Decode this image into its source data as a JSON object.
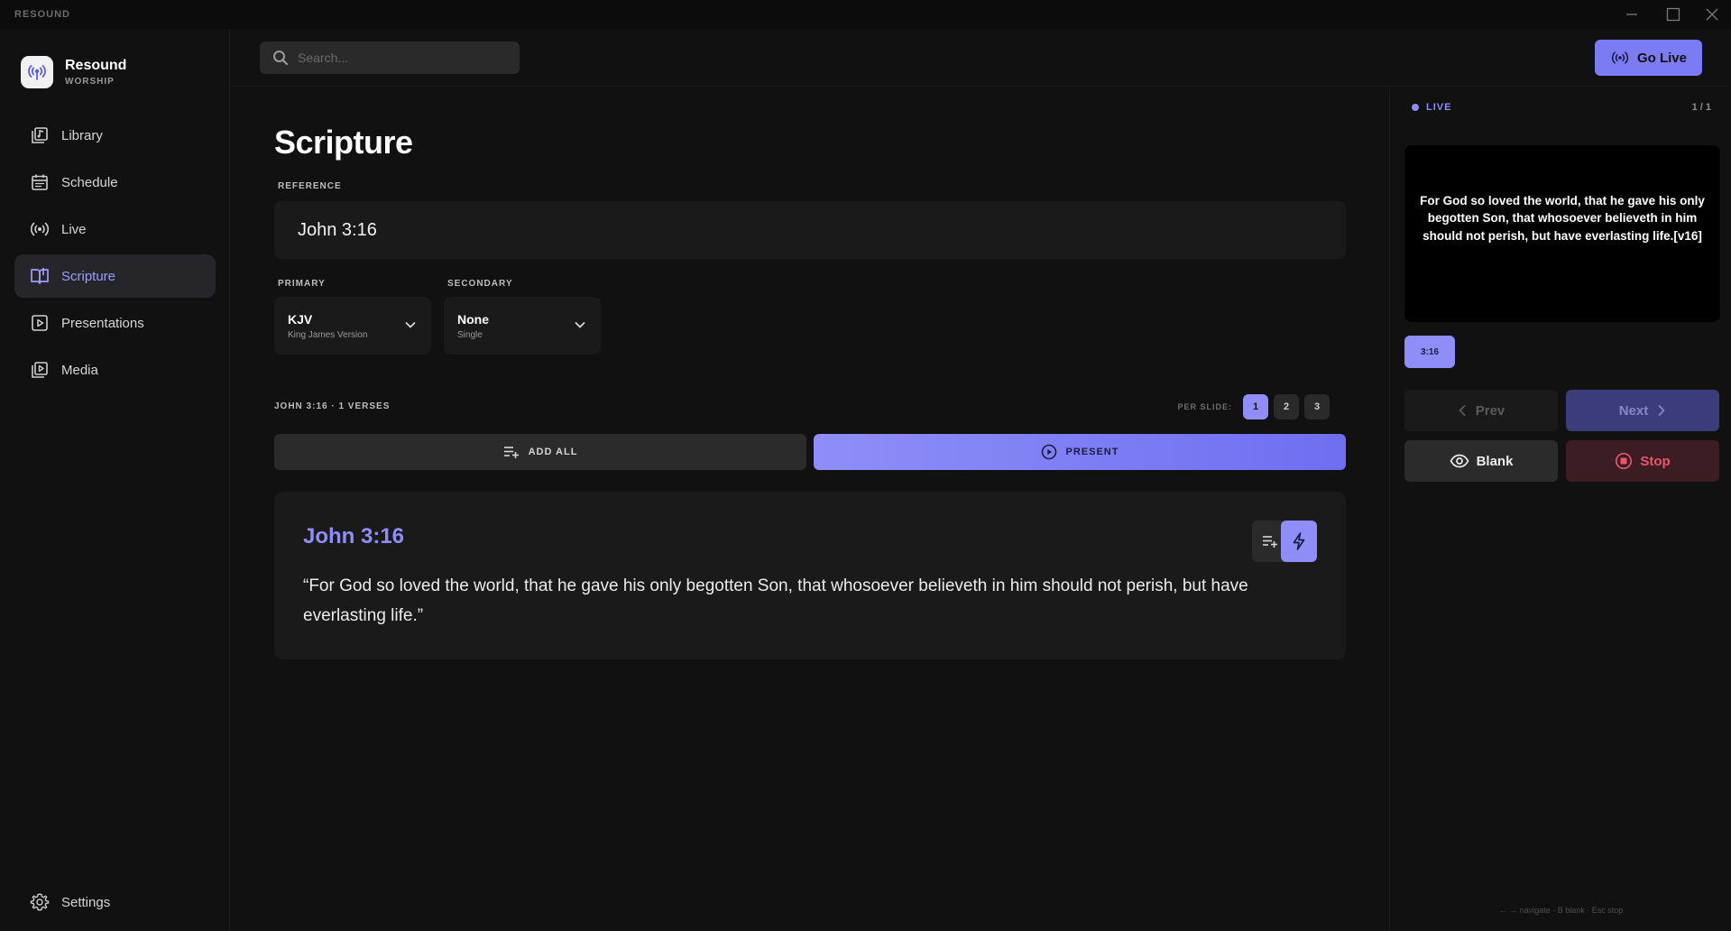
{
  "window": {
    "title": "RESOUND"
  },
  "brand": {
    "name": "Resound",
    "subtitle": "WORSHIP"
  },
  "sidebar": {
    "items": [
      {
        "label": "Library",
        "icon": "library-icon"
      },
      {
        "label": "Schedule",
        "icon": "calendar-icon"
      },
      {
        "label": "Live",
        "icon": "broadcast-icon"
      },
      {
        "label": "Scripture",
        "icon": "book-icon",
        "active": true
      },
      {
        "label": "Presentations",
        "icon": "play-square-icon"
      },
      {
        "label": "Media",
        "icon": "media-icon"
      }
    ],
    "settings_label": "Settings"
  },
  "topbar": {
    "search_placeholder": "Search...",
    "go_live_label": "Go Live"
  },
  "scripture": {
    "title": "Scripture",
    "reference_label": "REFERENCE",
    "reference_value": "John 3:16",
    "primary_label": "PRIMARY",
    "primary_value": "KJV",
    "primary_sub": "King James Version",
    "secondary_label": "SECONDARY",
    "secondary_value": "None",
    "secondary_sub": "Single",
    "count_label": "JOHN 3:16 · 1 VERSES",
    "per_slide_label": "PER SLIDE:",
    "per_slide_options": [
      "1",
      "2",
      "3"
    ],
    "per_slide_selected": "1",
    "add_all_label": "ADD ALL",
    "present_label": "PRESENT",
    "verse": {
      "ref": "John 3:16",
      "text": "“For God so loved the world, that he gave his only begotten Son, that whosoever believeth in him should not perish, but have everlasting life.”"
    }
  },
  "live_panel": {
    "status": "LIVE",
    "counter": "1 / 1",
    "preview_text": "For God so loved the world, that he gave his only begotten Son, that whosoever believeth in him should not perish, but have everlasting life.[v16]",
    "slide_chip": "3:16",
    "prev_label": "Prev",
    "next_label": "Next",
    "blank_label": "Blank",
    "stop_label": "Stop",
    "hint": "← → navigate · B blank · Esc stop"
  },
  "colors": {
    "accent": "#8f8ef8",
    "background": "#111111",
    "panel": "#1a1a1a",
    "stop": "#e8566b"
  }
}
